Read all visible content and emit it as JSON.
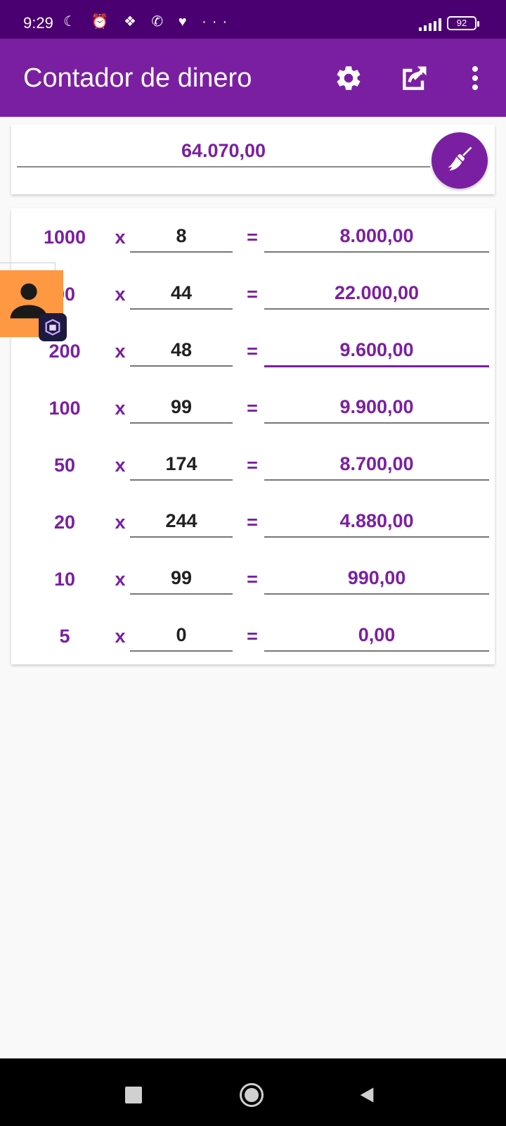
{
  "status_bar": {
    "time": "9:29",
    "icons_text": "☾ ⏰ ❖ ✆ ♥ ···",
    "battery": "92"
  },
  "app_bar": {
    "title": "Contador de dinero",
    "icons": [
      "settings-icon",
      "share-icon",
      "more-vert-icon"
    ]
  },
  "total": {
    "value": "64.070,00",
    "clear_icon": "broom-icon"
  },
  "rows": [
    {
      "denomination": "1000",
      "times": "x",
      "quantity": "8",
      "equals": "=",
      "subtotal": "8.000,00"
    },
    {
      "denomination": "00",
      "times": "x",
      "quantity": "44",
      "equals": "=",
      "subtotal": "22.000,00"
    },
    {
      "denomination": "200",
      "times": "x",
      "quantity": "48",
      "equals": "=",
      "subtotal": "9.600,00"
    },
    {
      "denomination": "100",
      "times": "x",
      "quantity": "99",
      "equals": "=",
      "subtotal": "9.900,00"
    },
    {
      "denomination": "50",
      "times": "x",
      "quantity": "174",
      "equals": "=",
      "subtotal": "8.700,00"
    },
    {
      "denomination": "20",
      "times": "x",
      "quantity": "244",
      "equals": "=",
      "subtotal": "4.880,00"
    },
    {
      "denomination": "10",
      "times": "x",
      "quantity": "99",
      "equals": "=",
      "subtotal": "990,00"
    },
    {
      "denomination": "5",
      "times": "x",
      "quantity": "0",
      "equals": "=",
      "subtotal": "0,00"
    }
  ],
  "colors": {
    "primary": "#7b1fa2",
    "status_bar": "#4a0070",
    "bubble": "#ff9843"
  },
  "nav_bar": {
    "icons": [
      "recents-square-icon",
      "home-circle-icon",
      "back-triangle-icon"
    ]
  }
}
